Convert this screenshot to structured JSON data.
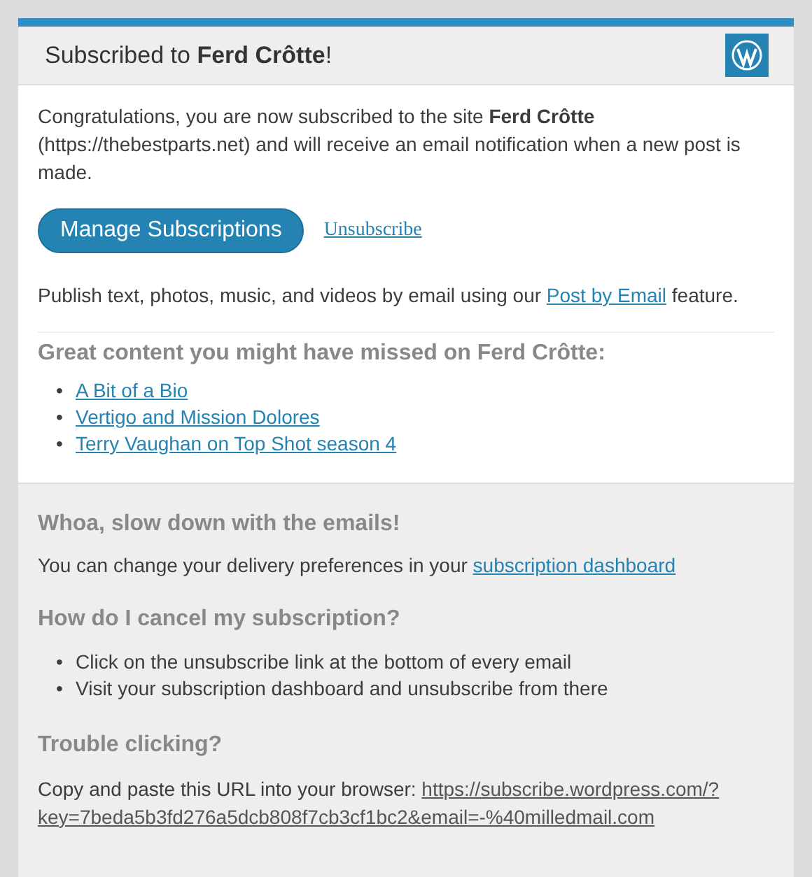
{
  "header": {
    "title": "Subscribed to **Ferd Crôtte**!"
  },
  "intro": "Congratulations, you are now subscribed to the site **Ferd Crôtte** (https://thebestparts.net) and will receive an email notification when a new post is made.",
  "actions": {
    "primary": "Manage Subscriptions",
    "secondary": "Unsubscribe"
  },
  "publish": {
    "before": "Publish text, photos, music, and videos by email using our",
    "link": "Post by Email",
    "after": "feature."
  },
  "missed": {
    "heading": "Great content you might have missed on Ferd Crôtte:",
    "posts": [
      {
        "bullet": "•",
        "title": "A Bit of a Bio"
      },
      {
        "bullet": "•",
        "title": "Vertigo and Mission Dolores"
      },
      {
        "bullet": "•",
        "title": "Terry Vaughan on Top Shot season 4"
      }
    ]
  },
  "footer": {
    "slow_heading": "Whoa, slow down with the emails!",
    "slow_text": "You can change your delivery preferences in your",
    "slow_link": "subscription dashboard",
    "cancel_heading": "How do I cancel my subscription?",
    "cancel_items": [
      {
        "bullet": "•",
        "text": "Click on the unsubscribe link at the bottom of every email"
      },
      {
        "bullet": "•",
        "text": "Visit your subscription dashboard and unsubscribe from there"
      }
    ],
    "trouble_heading": "Trouble clicking?",
    "trouble_text": "Copy and paste this URL into your browser:",
    "trouble_url": "https://subscribe.wordpress.com/?key=7beda5b3fd276a5dcb808f7cb3cf1bc2&email=-%40milledmail.com"
  }
}
